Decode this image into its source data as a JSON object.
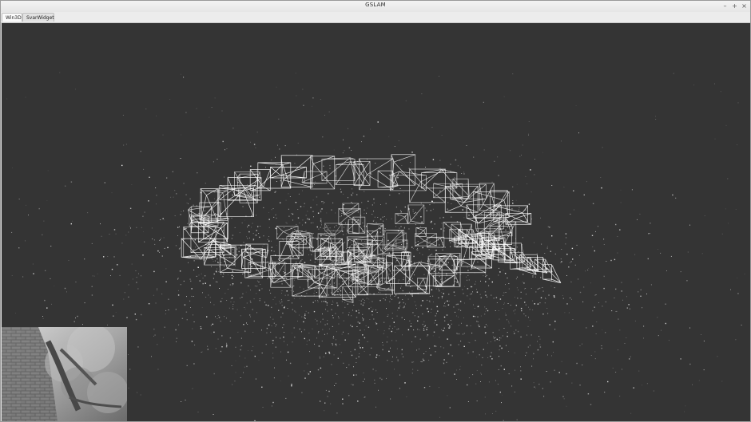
{
  "window": {
    "title": "GSLAM",
    "controls": {
      "minimize": "–",
      "maximize": "+",
      "close": "×"
    }
  },
  "tabs": [
    {
      "label": "Win3D",
      "active": true
    },
    {
      "label": "SvarWidget",
      "active": false
    }
  ],
  "viewer": {
    "background_color": "#343434",
    "point_color": "#ffffff",
    "keyframe_color": "#ffffff"
  },
  "camera_view": {
    "icon": "camera-image"
  }
}
